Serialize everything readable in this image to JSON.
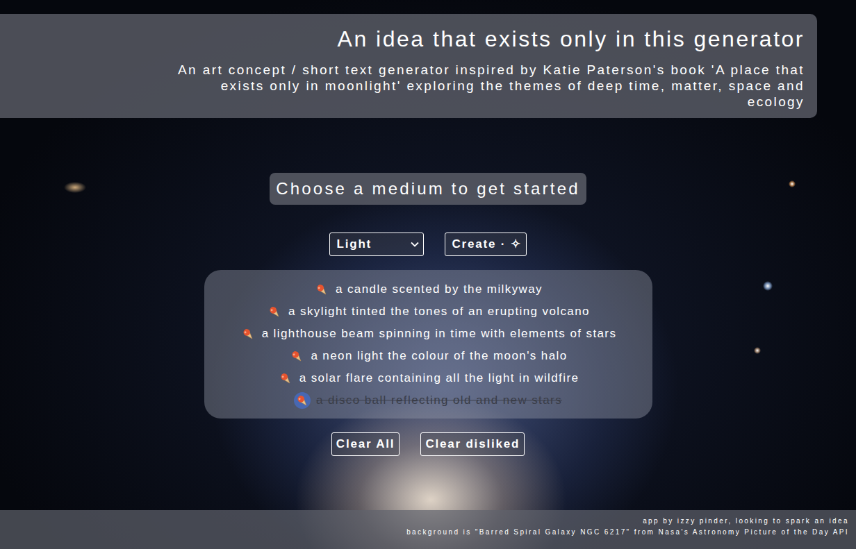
{
  "header": {
    "title": "An idea that exists only in this generator",
    "subtitle": "An art concept / short text generator inspired by Katie Paterson's book 'A place that exists only in moonlight' exploring the themes of deep time, matter, space and ecology"
  },
  "prompt": "Choose a medium to get started",
  "medium_select": {
    "value": "Light"
  },
  "create_button": "Create · ✧",
  "ideas": [
    {
      "text": "a candle scented by the milkyway",
      "disliked": false
    },
    {
      "text": "a skylight tinted the tones of an erupting volcano",
      "disliked": false
    },
    {
      "text": "a lighthouse beam spinning in time with elements of stars",
      "disliked": false
    },
    {
      "text": "a neon light the colour of the moon's halo",
      "disliked": false
    },
    {
      "text": "a solar flare containing all the light in wildfire",
      "disliked": false
    },
    {
      "text": "a disco ball reflecting old and new stars",
      "disliked": true
    }
  ],
  "buttons": [
    "Clear All",
    "Clear disliked"
  ],
  "footer": [
    "app by izzy pinder, looking to spark an idea",
    "background is \"Barred Spiral Galaxy NGC 6217\" from Nasa's Astronomy Picture of the Day API"
  ]
}
